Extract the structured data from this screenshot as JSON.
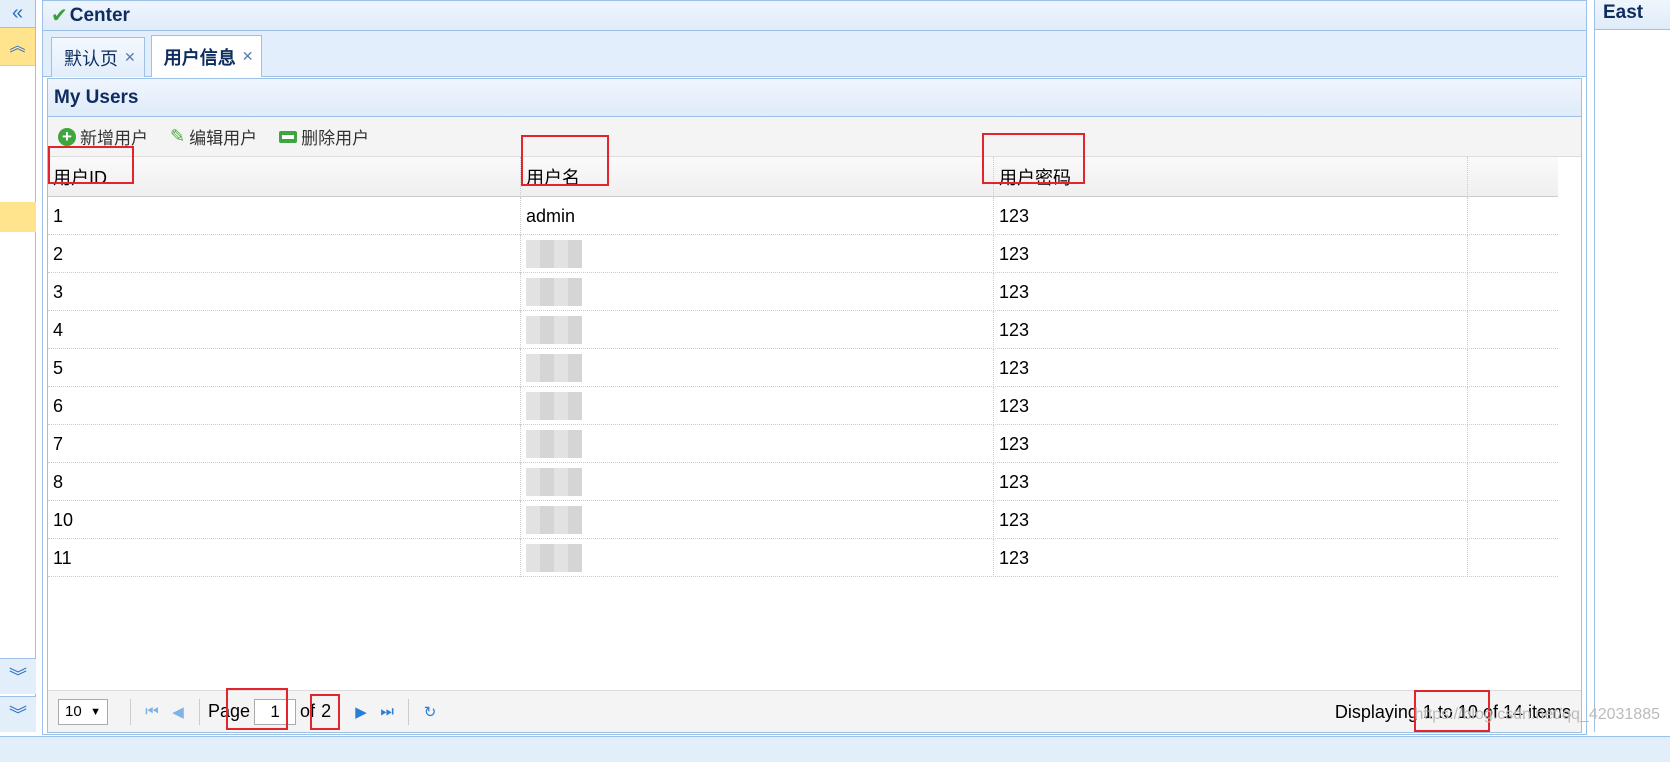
{
  "west": {
    "collapse_icon": "double-chevron-left-icon",
    "expand_icon": "double-chevron-up-icon",
    "down_icon": "double-chevron-down-icon"
  },
  "center": {
    "title": "Center",
    "tabs": [
      {
        "label": "默认页",
        "selected": false
      },
      {
        "label": "用户信息",
        "selected": true
      }
    ]
  },
  "panel": {
    "title": "My Users",
    "toolbar": {
      "add_label": "新增用户",
      "edit_label": "编辑用户",
      "remove_label": "删除用户"
    },
    "columns": [
      "用户ID",
      "用户名",
      "用户密码"
    ],
    "rows": [
      {
        "id": "1",
        "name": "admin",
        "password": "123"
      },
      {
        "id": "2",
        "name": "",
        "password": "123"
      },
      {
        "id": "3",
        "name": "",
        "password": "123"
      },
      {
        "id": "4",
        "name": "",
        "password": "123"
      },
      {
        "id": "5",
        "name": "",
        "password": "123"
      },
      {
        "id": "6",
        "name": "",
        "password": "123"
      },
      {
        "id": "7",
        "name": "",
        "password": "123"
      },
      {
        "id": "8",
        "name": "",
        "password": "123"
      },
      {
        "id": "10",
        "name": "",
        "password": "123"
      },
      {
        "id": "11",
        "name": "",
        "password": "123"
      }
    ]
  },
  "pager": {
    "page_size": "10",
    "page_label": "Page",
    "current_page": "1",
    "of_label": "of",
    "total_pages": "2",
    "info": "Displaying 1 to 10 of 14 items"
  },
  "east": {
    "title": "East"
  },
  "watermark": "https://blog.csdn.net/qq_42031885",
  "colors": {
    "accent": "#9dc1e6",
    "highlight": "#e3242b",
    "selected_strip": "#ffe48d"
  }
}
